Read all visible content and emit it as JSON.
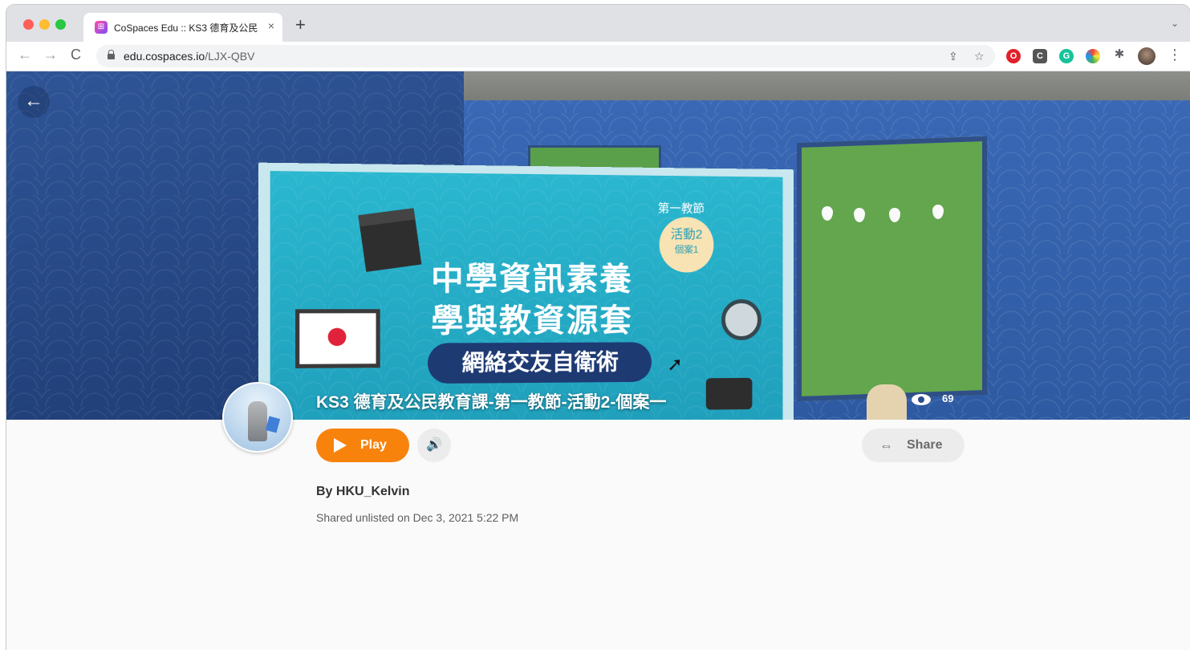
{
  "browser": {
    "tab_title": "CoSpaces Edu :: KS3 德育及公民",
    "tab_close": "×",
    "new_tab": "+",
    "tab_search": "⌄",
    "nav_back": "←",
    "nav_forward": "→",
    "nav_reload": "C",
    "url_host": "edu.cospaces.io",
    "url_path": "/LJX-QBV",
    "share_icon": "⇪",
    "bookmark_icon": "☆",
    "menu_dots": "⋮",
    "extensions": [
      "opera-icon",
      "c-extension-icon",
      "grammarly-icon",
      "color-picker-icon",
      "puzzle-icon"
    ]
  },
  "hero": {
    "back_label": "←",
    "board_lesson": "第一教節",
    "board_badge_line1": "活動2",
    "board_badge_line2": "個案1",
    "board_title1": "中學資訊素養",
    "board_title2": "學與教資源套",
    "board_pill": "網絡交友自衛術",
    "title": "KS3 德育及公民教育課-第一教節-活動2-個案一",
    "views": "69"
  },
  "actions": {
    "play_label": "Play",
    "sound_icon": "🔊",
    "share_label": "Share",
    "link_icon": "⇔"
  },
  "details": {
    "author": "By HKU_Kelvin",
    "shared": "Shared unlisted on Dec 3, 2021 5:22 PM"
  },
  "colors": {
    "accent": "#f7830d",
    "wall_blue": "#2e5aa2",
    "board_teal": "#2ab7cf"
  }
}
